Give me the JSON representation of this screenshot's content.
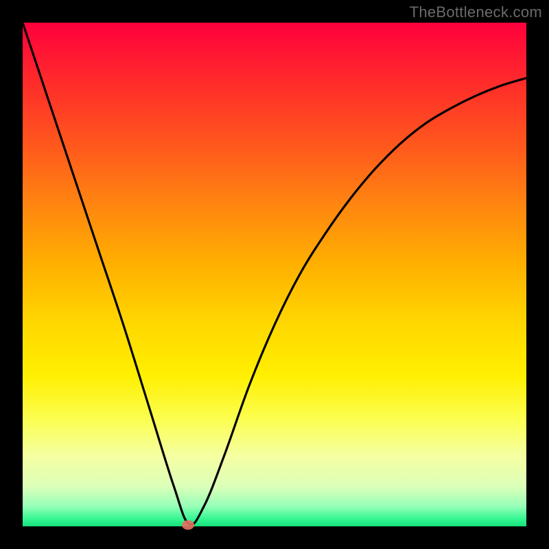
{
  "watermark": "TheBottleneck.com",
  "chart_data": {
    "type": "line",
    "title": "",
    "xlabel": "",
    "ylabel": "",
    "xlim": [
      0,
      100
    ],
    "ylim": [
      0,
      100
    ],
    "description": "V-shaped bottleneck deviation curve over red-yellow-green vertical gradient; minimum at x≈33",
    "series": [
      {
        "name": "curve",
        "x": [
          0,
          5,
          10,
          15,
          20,
          25,
          30,
          33,
          36,
          40,
          45,
          50,
          55,
          60,
          65,
          70,
          75,
          80,
          85,
          90,
          95,
          100
        ],
        "y": [
          100,
          85,
          70,
          55,
          40,
          24,
          8,
          0.5,
          4,
          14,
          28,
          40,
          50,
          58,
          65,
          71,
          76,
          80,
          83,
          85.5,
          87.5,
          89
        ]
      }
    ],
    "marker": {
      "x": 33,
      "y": 0.5
    }
  }
}
